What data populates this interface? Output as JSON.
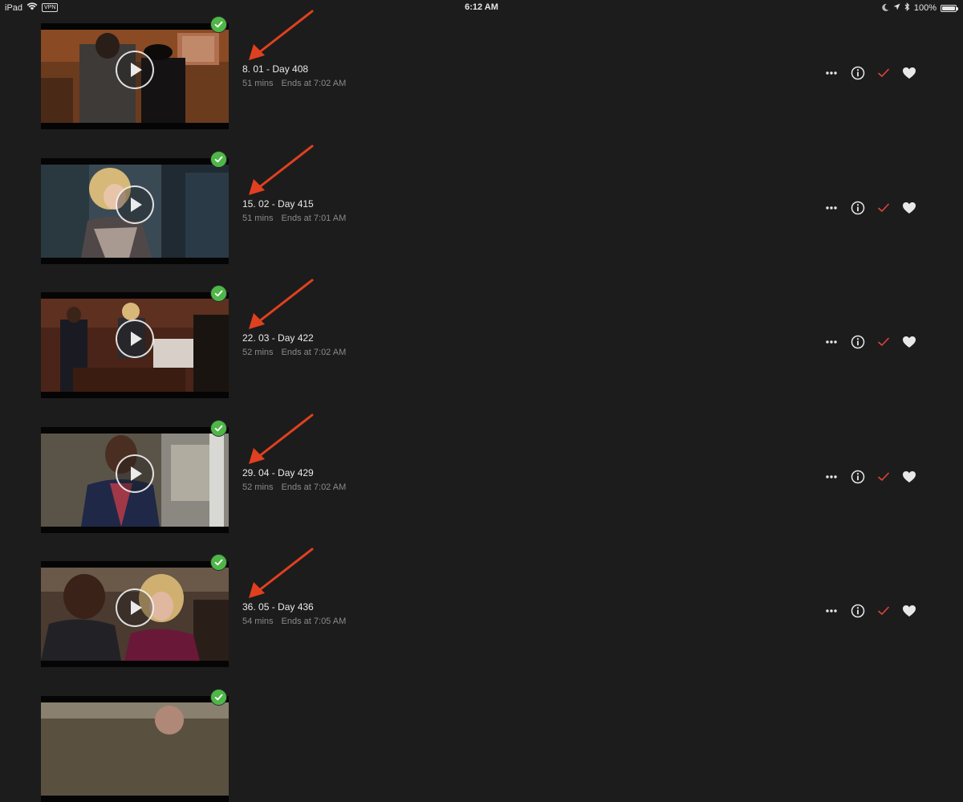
{
  "status_bar": {
    "device": "iPad",
    "vpn": "VPN",
    "time": "6:12 AM",
    "battery": "100%",
    "battery_level": 1.0
  },
  "colors": {
    "background": "#1c1c1c",
    "watched_badge": "#4fb648",
    "check_accent": "#e0453a",
    "annotation_arrow": "#e0401f"
  },
  "icons": {
    "more": "more-dots-icon",
    "info": "info-icon",
    "watched": "checkmark-icon",
    "favorite": "heart-icon",
    "play": "play-icon"
  },
  "episodes": [
    {
      "title": "8. 01 - Day 408",
      "duration": "51 mins",
      "ends": "Ends at 7:02 AM"
    },
    {
      "title": "15. 02 - Day 415",
      "duration": "51 mins",
      "ends": "Ends at 7:01 AM"
    },
    {
      "title": "22. 03 - Day 422",
      "duration": "52 mins",
      "ends": "Ends at 7:02 AM"
    },
    {
      "title": "29. 04 - Day 429",
      "duration": "52 mins",
      "ends": "Ends at 7:02 AM"
    },
    {
      "title": "36. 05 - Day 436",
      "duration": "54 mins",
      "ends": "Ends at 7:05 AM"
    },
    {
      "title": "",
      "duration": "",
      "ends": ""
    }
  ]
}
